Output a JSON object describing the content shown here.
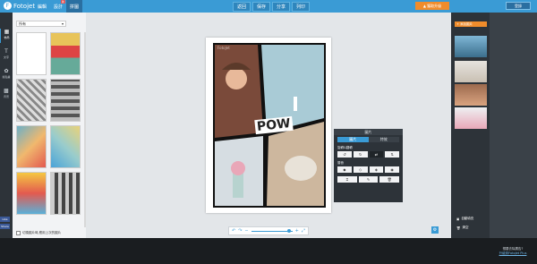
{
  "app": {
    "name": "Fotojet"
  },
  "topbar": {
    "tabs": [
      {
        "label": "編輯"
      },
      {
        "label": "設計",
        "badge": "新"
      },
      {
        "label": "拼圖"
      }
    ],
    "tools": [
      "返回",
      "保存",
      "分享",
      "列印"
    ],
    "upgrade": "▲ 獲取升級",
    "login": "登錄"
  },
  "leftnav": {
    "items": [
      {
        "label": "佈局",
        "icon": "grid-icon"
      },
      {
        "label": "文字",
        "icon": "text-icon"
      },
      {
        "label": "剪貼畫",
        "icon": "clipart-icon"
      },
      {
        "label": "背景",
        "icon": "background-icon"
      }
    ],
    "social": [
      "Like",
      "Share"
    ]
  },
  "panel": {
    "filter": "所有",
    "checkbox_label": "切換圖片時,應用上次的圖片"
  },
  "canvas": {
    "watermark": "FotoJet",
    "pow": "POW"
  },
  "zoombar": {
    "undo": "↶",
    "redo": "↷",
    "minus": "−",
    "plus": "+",
    "fit": "⤢"
  },
  "props": {
    "title": "圖片",
    "tabs": [
      "圖片",
      "特效"
    ],
    "rotate_label": "旋轉&翻轉",
    "layer_label": "層疊"
  },
  "rightpanel": {
    "add": "+ 添加圖片",
    "autofill": "自動填充",
    "clear": "清空"
  },
  "promo": {
    "line1": "想要去除廣告?",
    "link": "升級到FotoJet Plus"
  },
  "colors": {
    "accent": "#3a9bd5",
    "orange": "#f08c2b",
    "dark": "#2d3339"
  }
}
